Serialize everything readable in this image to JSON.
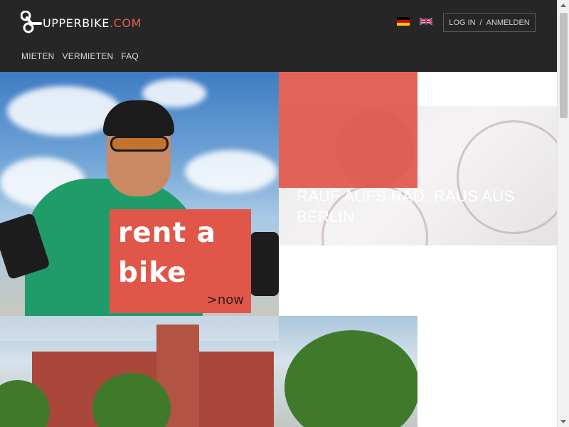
{
  "header": {
    "logo_brand": "UPPERBIKE",
    "logo_tld": ".COM",
    "login_label": "LOG IN",
    "separator": "/",
    "register_label": "ANMELDEN",
    "languages": [
      {
        "code": "de",
        "icon": "flag-germany-icon"
      },
      {
        "code": "en",
        "icon": "flag-uk-icon"
      }
    ]
  },
  "nav": {
    "items": [
      {
        "label": "MIETEN"
      },
      {
        "label": "VERMIETEN"
      },
      {
        "label": "FAQ"
      }
    ]
  },
  "hero": {
    "rent_line1": "rent a",
    "rent_line2": "bike",
    "rent_now": ">now",
    "tagline": "RAUF AUFS RAD. RAUS AUS BERLIN"
  },
  "colors": {
    "header_bg": "#262626",
    "accent": "#e0574a",
    "tld": "#e0604f"
  }
}
